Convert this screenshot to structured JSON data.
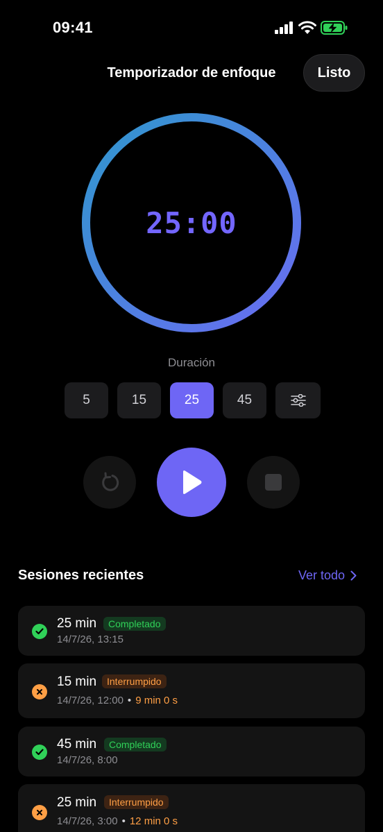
{
  "status_bar": {
    "time": "09:41"
  },
  "header": {
    "title": "Temporizador de enfoque",
    "done_label": "Listo"
  },
  "timer": {
    "display": "25:00",
    "progress": 1.0,
    "gradient_start": "#6a6cf2",
    "gradient_end": "#2f97cd"
  },
  "duration": {
    "label": "Duración",
    "options": [
      "5",
      "15",
      "25",
      "45"
    ],
    "selected": "25"
  },
  "controls": {
    "reset_icon": "reset-icon",
    "play_icon": "play-icon",
    "stop_icon": "stop-icon"
  },
  "sessions": {
    "title": "Sesiones recientes",
    "see_all_label": "Ver todo",
    "items": [
      {
        "duration": "25 min",
        "status": "Completado",
        "date": "14/7/26, 13:15",
        "elapsed": ""
      },
      {
        "duration": "15 min",
        "status": "Interrumpido",
        "date": "14/7/26, 12:00",
        "elapsed": "9 min 0 s"
      },
      {
        "duration": "45 min",
        "status": "Completado",
        "date": "14/7/26, 8:00",
        "elapsed": ""
      },
      {
        "duration": "25 min",
        "status": "Interrumpido",
        "date": "14/7/26, 3:00",
        "elapsed": "12 min 0 s"
      }
    ]
  },
  "colors": {
    "accent": "#6e66f5",
    "success": "#30d158",
    "warning": "#ff9f45"
  }
}
